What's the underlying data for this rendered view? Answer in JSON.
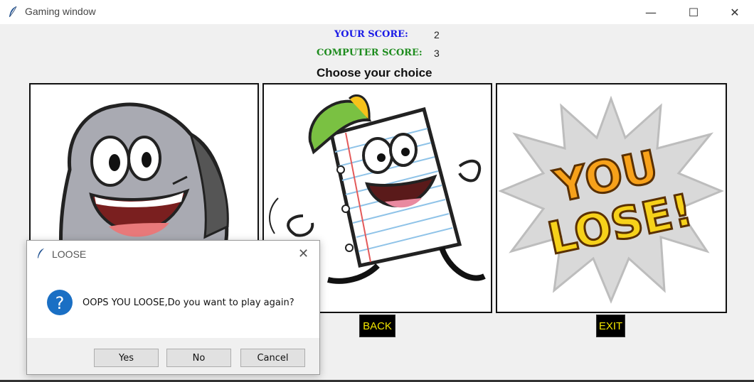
{
  "window": {
    "title": "Gaming window",
    "minimize_glyph": "—",
    "maximize_glyph": "☐",
    "close_glyph": "✕"
  },
  "scores": {
    "your_label": "YOUR SCORE:",
    "your_value": "2",
    "computer_label": "COMPUTER SCORE:",
    "computer_value": "3",
    "your_color": "#1a1ae6",
    "computer_color": "#1e8c1e"
  },
  "prompt": "Choose your choice",
  "panels": {
    "rock": {
      "icon": "rock-character-icon"
    },
    "paper": {
      "icon": "paper-character-icon"
    },
    "result": {
      "text_line1": "YOU",
      "text_line2": "LOSE!"
    }
  },
  "buttons": {
    "back": "BACK",
    "exit": "EXIT"
  },
  "dialog": {
    "title": "LOOSE",
    "message": "OOPS YOU LOOSE,Do you want to play again?",
    "close_glyph": "✕",
    "icon": "question-icon",
    "yes": "Yes",
    "no": "No",
    "cancel": "Cancel"
  }
}
